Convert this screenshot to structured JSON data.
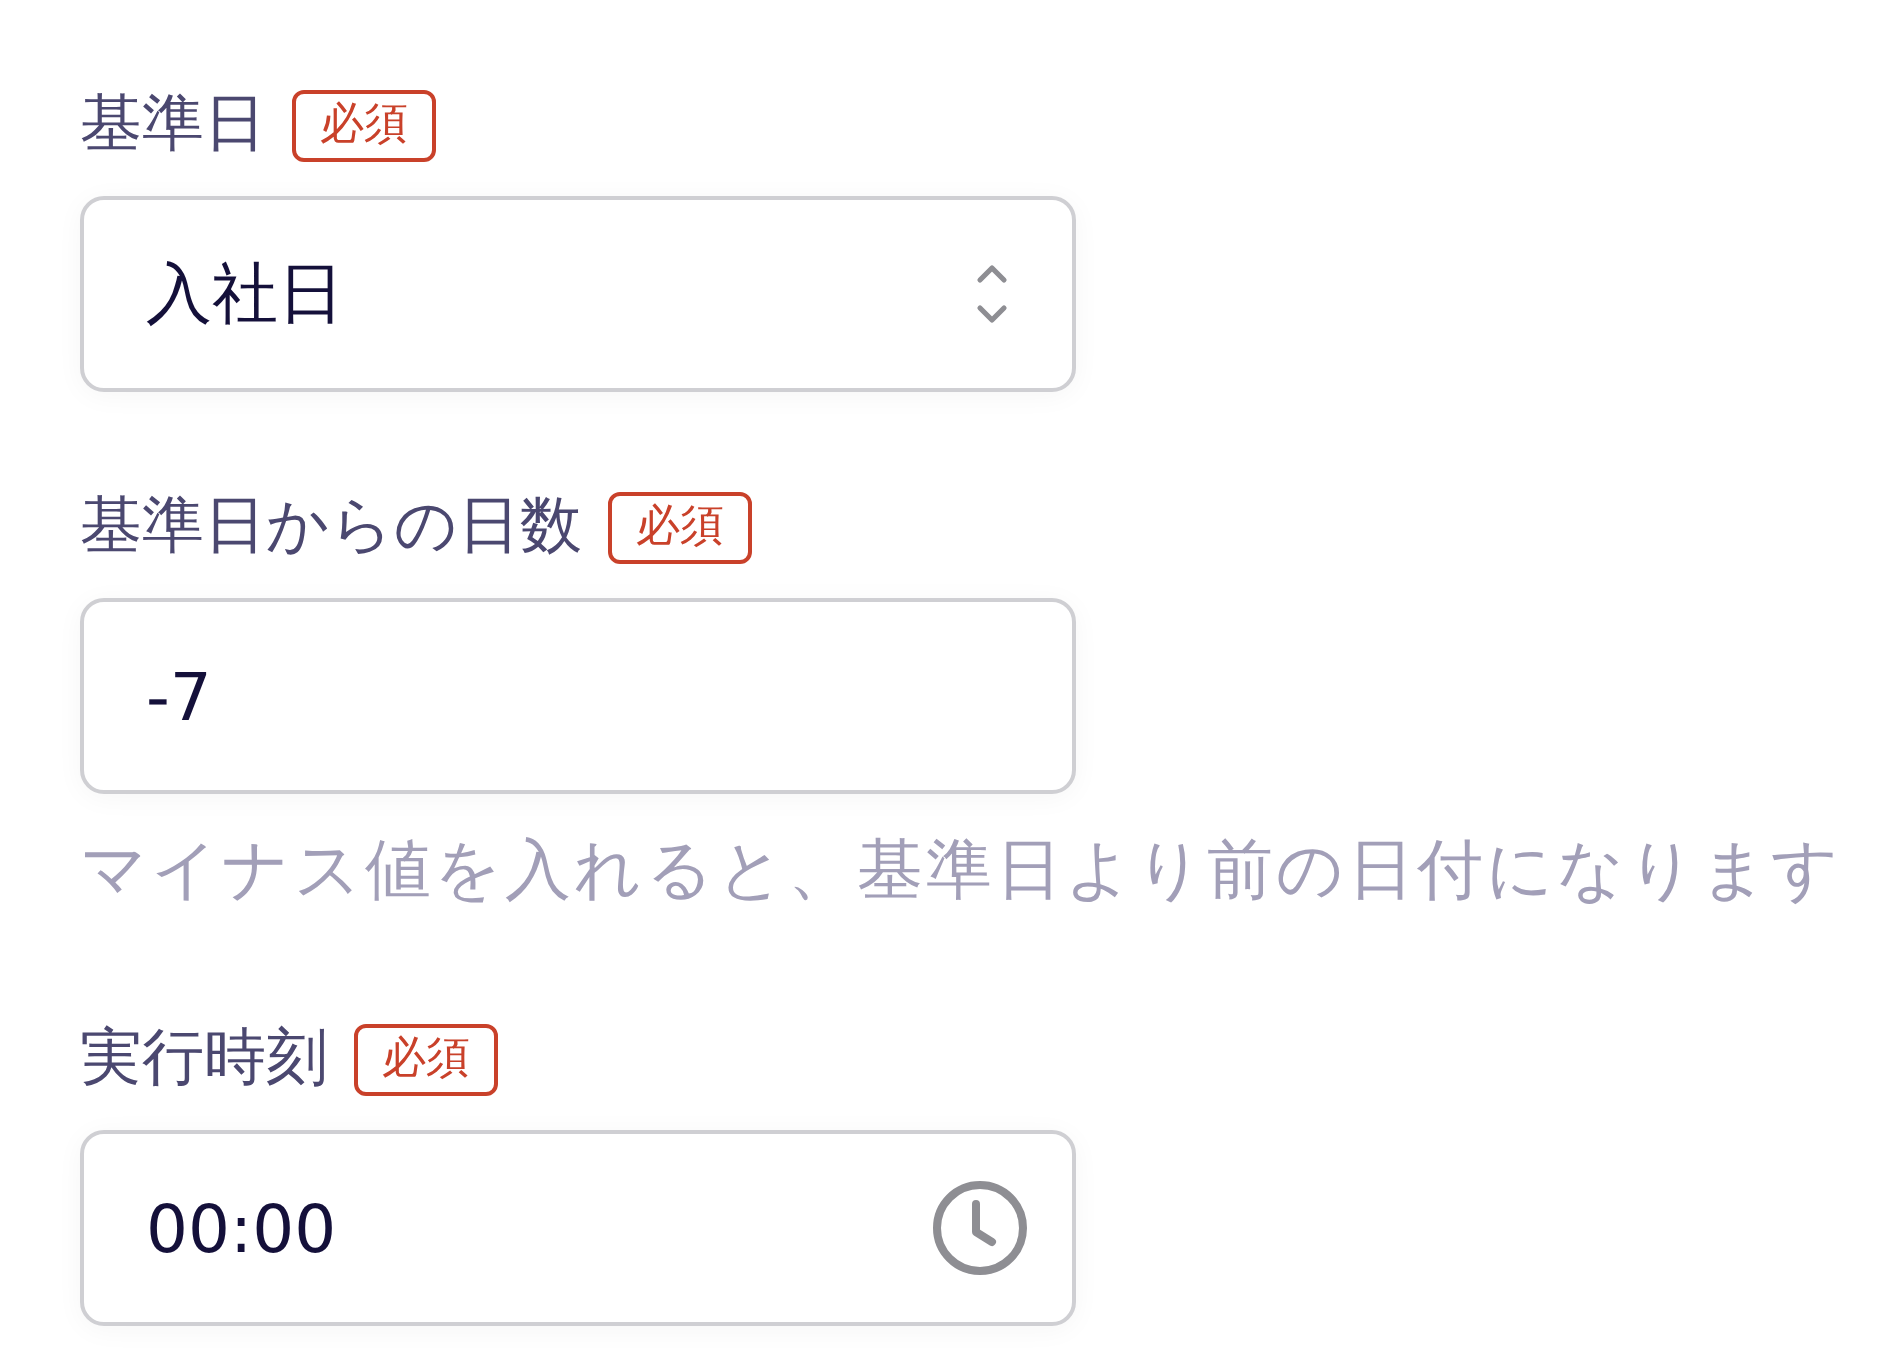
{
  "fields": [
    {
      "label": "基準日",
      "badge": "必須",
      "kind": "select",
      "value": "入社日"
    },
    {
      "label": "基準日からの日数",
      "badge": "必須",
      "kind": "number",
      "value": "-7",
      "hint": "マイナス値を入れると、基準日より前の日付になります"
    },
    {
      "label": "実行時刻",
      "badge": "必須",
      "kind": "time",
      "value": "00:00"
    }
  ]
}
